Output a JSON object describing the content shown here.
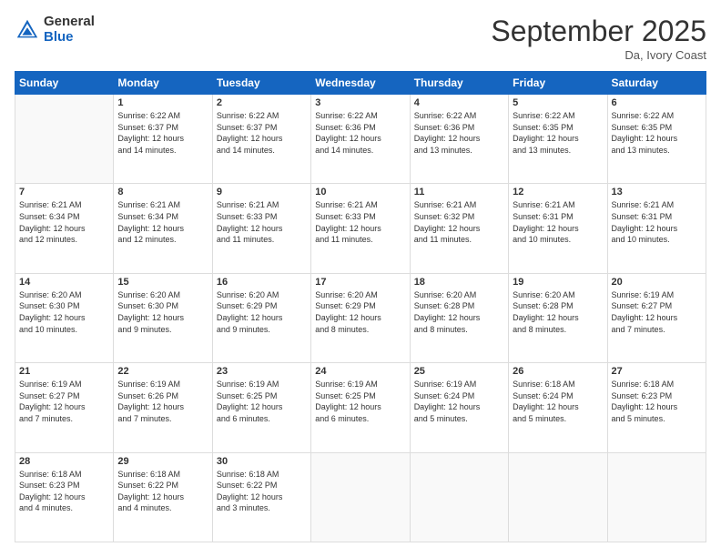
{
  "logo": {
    "general": "General",
    "blue": "Blue"
  },
  "title": "September 2025",
  "location": "Da, Ivory Coast",
  "days_header": [
    "Sunday",
    "Monday",
    "Tuesday",
    "Wednesday",
    "Thursday",
    "Friday",
    "Saturday"
  ],
  "weeks": [
    [
      {
        "day": "",
        "info": ""
      },
      {
        "day": "1",
        "info": "Sunrise: 6:22 AM\nSunset: 6:37 PM\nDaylight: 12 hours\nand 14 minutes."
      },
      {
        "day": "2",
        "info": "Sunrise: 6:22 AM\nSunset: 6:37 PM\nDaylight: 12 hours\nand 14 minutes."
      },
      {
        "day": "3",
        "info": "Sunrise: 6:22 AM\nSunset: 6:36 PM\nDaylight: 12 hours\nand 14 minutes."
      },
      {
        "day": "4",
        "info": "Sunrise: 6:22 AM\nSunset: 6:36 PM\nDaylight: 12 hours\nand 13 minutes."
      },
      {
        "day": "5",
        "info": "Sunrise: 6:22 AM\nSunset: 6:35 PM\nDaylight: 12 hours\nand 13 minutes."
      },
      {
        "day": "6",
        "info": "Sunrise: 6:22 AM\nSunset: 6:35 PM\nDaylight: 12 hours\nand 13 minutes."
      }
    ],
    [
      {
        "day": "7",
        "info": "Sunrise: 6:21 AM\nSunset: 6:34 PM\nDaylight: 12 hours\nand 12 minutes."
      },
      {
        "day": "8",
        "info": "Sunrise: 6:21 AM\nSunset: 6:34 PM\nDaylight: 12 hours\nand 12 minutes."
      },
      {
        "day": "9",
        "info": "Sunrise: 6:21 AM\nSunset: 6:33 PM\nDaylight: 12 hours\nand 11 minutes."
      },
      {
        "day": "10",
        "info": "Sunrise: 6:21 AM\nSunset: 6:33 PM\nDaylight: 12 hours\nand 11 minutes."
      },
      {
        "day": "11",
        "info": "Sunrise: 6:21 AM\nSunset: 6:32 PM\nDaylight: 12 hours\nand 11 minutes."
      },
      {
        "day": "12",
        "info": "Sunrise: 6:21 AM\nSunset: 6:31 PM\nDaylight: 12 hours\nand 10 minutes."
      },
      {
        "day": "13",
        "info": "Sunrise: 6:21 AM\nSunset: 6:31 PM\nDaylight: 12 hours\nand 10 minutes."
      }
    ],
    [
      {
        "day": "14",
        "info": "Sunrise: 6:20 AM\nSunset: 6:30 PM\nDaylight: 12 hours\nand 10 minutes."
      },
      {
        "day": "15",
        "info": "Sunrise: 6:20 AM\nSunset: 6:30 PM\nDaylight: 12 hours\nand 9 minutes."
      },
      {
        "day": "16",
        "info": "Sunrise: 6:20 AM\nSunset: 6:29 PM\nDaylight: 12 hours\nand 9 minutes."
      },
      {
        "day": "17",
        "info": "Sunrise: 6:20 AM\nSunset: 6:29 PM\nDaylight: 12 hours\nand 8 minutes."
      },
      {
        "day": "18",
        "info": "Sunrise: 6:20 AM\nSunset: 6:28 PM\nDaylight: 12 hours\nand 8 minutes."
      },
      {
        "day": "19",
        "info": "Sunrise: 6:20 AM\nSunset: 6:28 PM\nDaylight: 12 hours\nand 8 minutes."
      },
      {
        "day": "20",
        "info": "Sunrise: 6:19 AM\nSunset: 6:27 PM\nDaylight: 12 hours\nand 7 minutes."
      }
    ],
    [
      {
        "day": "21",
        "info": "Sunrise: 6:19 AM\nSunset: 6:27 PM\nDaylight: 12 hours\nand 7 minutes."
      },
      {
        "day": "22",
        "info": "Sunrise: 6:19 AM\nSunset: 6:26 PM\nDaylight: 12 hours\nand 7 minutes."
      },
      {
        "day": "23",
        "info": "Sunrise: 6:19 AM\nSunset: 6:25 PM\nDaylight: 12 hours\nand 6 minutes."
      },
      {
        "day": "24",
        "info": "Sunrise: 6:19 AM\nSunset: 6:25 PM\nDaylight: 12 hours\nand 6 minutes."
      },
      {
        "day": "25",
        "info": "Sunrise: 6:19 AM\nSunset: 6:24 PM\nDaylight: 12 hours\nand 5 minutes."
      },
      {
        "day": "26",
        "info": "Sunrise: 6:18 AM\nSunset: 6:24 PM\nDaylight: 12 hours\nand 5 minutes."
      },
      {
        "day": "27",
        "info": "Sunrise: 6:18 AM\nSunset: 6:23 PM\nDaylight: 12 hours\nand 5 minutes."
      }
    ],
    [
      {
        "day": "28",
        "info": "Sunrise: 6:18 AM\nSunset: 6:23 PM\nDaylight: 12 hours\nand 4 minutes."
      },
      {
        "day": "29",
        "info": "Sunrise: 6:18 AM\nSunset: 6:22 PM\nDaylight: 12 hours\nand 4 minutes."
      },
      {
        "day": "30",
        "info": "Sunrise: 6:18 AM\nSunset: 6:22 PM\nDaylight: 12 hours\nand 3 minutes."
      },
      {
        "day": "",
        "info": ""
      },
      {
        "day": "",
        "info": ""
      },
      {
        "day": "",
        "info": ""
      },
      {
        "day": "",
        "info": ""
      }
    ]
  ]
}
